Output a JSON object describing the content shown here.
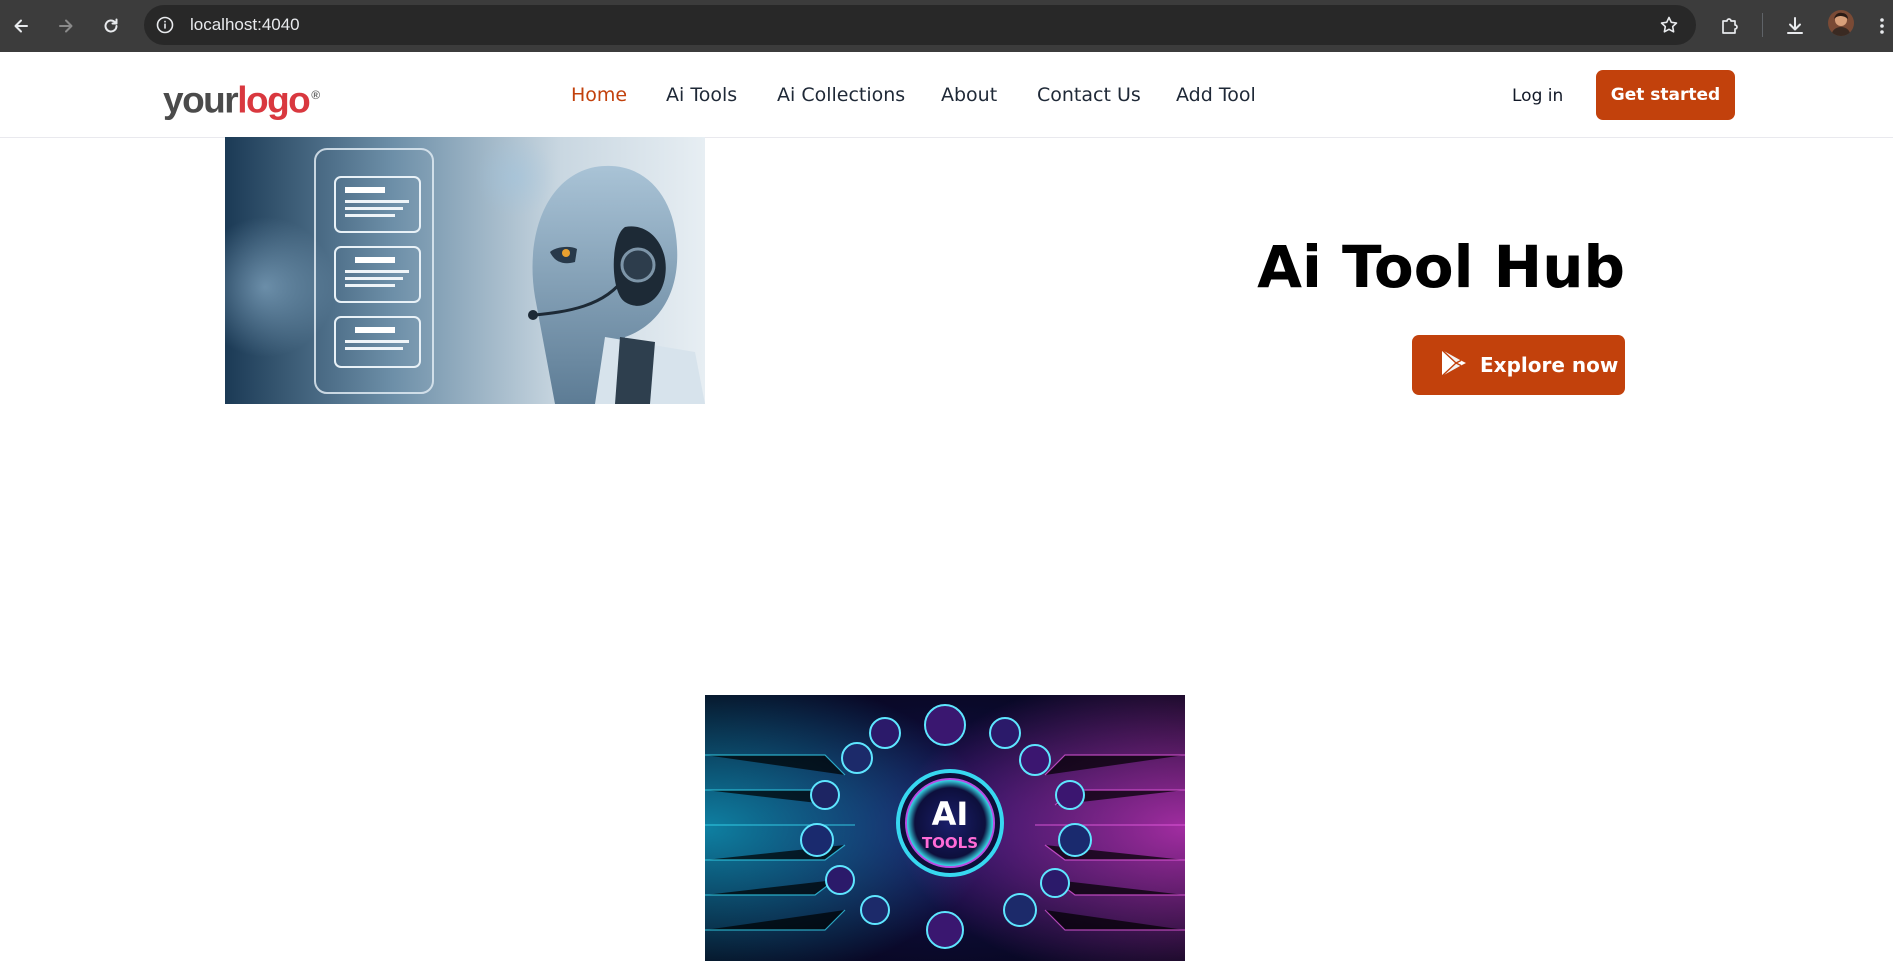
{
  "browser": {
    "url": "localhost:4040",
    "icons": [
      "back-icon",
      "forward-icon",
      "reload-icon",
      "info-icon",
      "star-icon",
      "extensions-icon",
      "download-icon",
      "profile-avatar",
      "menu-icon"
    ]
  },
  "header": {
    "logo": {
      "part1": "your",
      "part2": "logo",
      "mark": "®"
    },
    "nav": [
      {
        "label": "Home",
        "active": true
      },
      {
        "label": "Ai Tools",
        "active": false
      },
      {
        "label": "Ai Collections",
        "active": false
      },
      {
        "label": "About",
        "active": false
      },
      {
        "label": "Contact Us",
        "active": false
      },
      {
        "label": "Add Tool",
        "active": false
      }
    ],
    "login_label": "Log in",
    "cta_label": "Get started"
  },
  "hero": {
    "title": "Ai Tool Hub",
    "button_label": "Explore now",
    "button_icon": "play-store-icon",
    "image_icon": "robot-chat-illustration"
  },
  "section2": {
    "image_text_main": "AI",
    "image_text_sub": "TOOLS"
  },
  "colors": {
    "accent": "#c2410c",
    "chrome_bg": "#3c3c3c",
    "omnibox_bg": "#282828"
  }
}
